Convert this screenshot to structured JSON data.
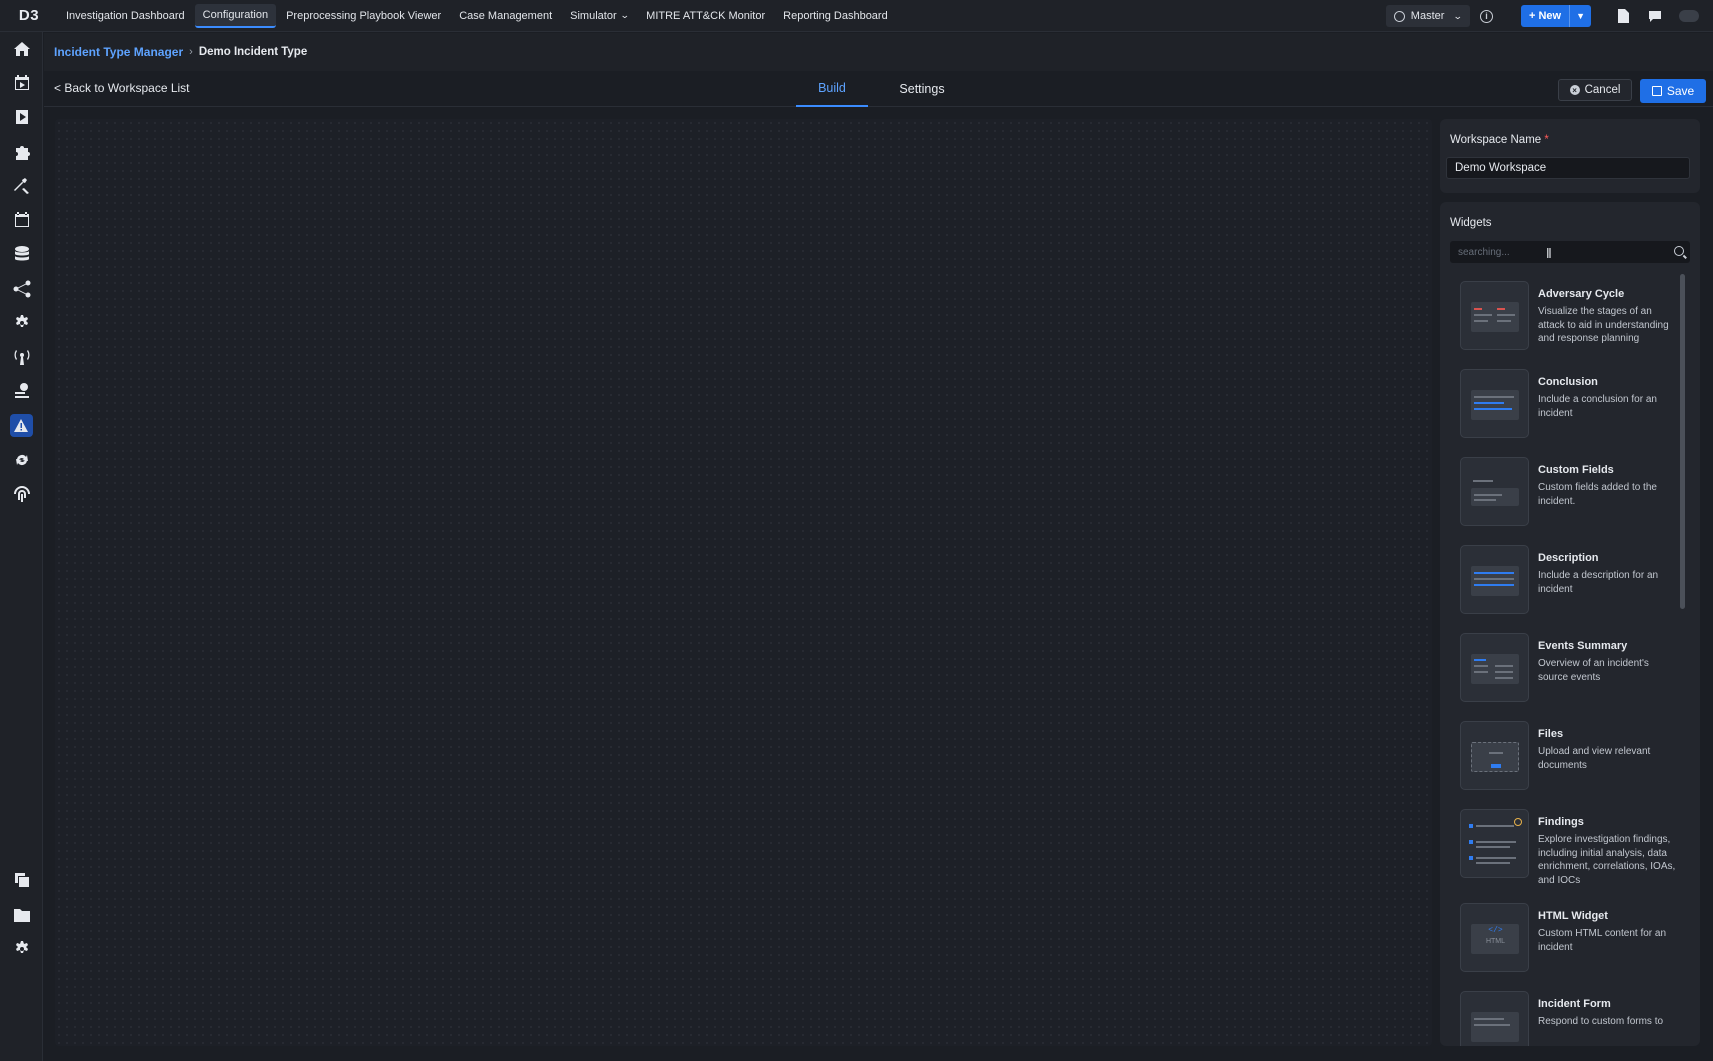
{
  "topnav": {
    "logo": "D3",
    "items": [
      {
        "label": "Investigation Dashboard",
        "active": false
      },
      {
        "label": "Configuration",
        "active": true
      },
      {
        "label": "Preprocessing Playbook Viewer",
        "active": false
      },
      {
        "label": "Case Management",
        "active": false
      },
      {
        "label": "Simulator",
        "active": false,
        "dropdown": true
      },
      {
        "label": "MITRE ATT&CK Monitor",
        "active": false
      },
      {
        "label": "Reporting Dashboard",
        "active": false
      }
    ],
    "master_label": "Master",
    "new_label": "+ New"
  },
  "breadcrumb": {
    "parent": "Incident Type Manager",
    "current": "Demo Incident Type"
  },
  "subheader": {
    "back_label": "< Back to Workspace List",
    "tabs": [
      {
        "label": "Build",
        "active": true
      },
      {
        "label": "Settings",
        "active": false
      }
    ],
    "cancel_label": "Cancel",
    "save_label": "Save"
  },
  "workspace": {
    "label": "Workspace Name",
    "required_mark": "*",
    "value": "Demo Workspace"
  },
  "widgets": {
    "title": "Widgets",
    "search_placeholder": "searching...",
    "items": [
      {
        "name": "Adversary Cycle",
        "desc": "Visualize the stages of an attack to aid in understanding and response planning"
      },
      {
        "name": "Conclusion",
        "desc": "Include a conclusion for an incident"
      },
      {
        "name": "Custom Fields",
        "desc": "Custom fields added to the incident."
      },
      {
        "name": "Description",
        "desc": "Include a description for an incident"
      },
      {
        "name": "Events Summary",
        "desc": "Overview of an incident's source events"
      },
      {
        "name": "Files",
        "desc": "Upload and view relevant documents"
      },
      {
        "name": "Findings",
        "desc": "Explore investigation findings, including initial analysis, data enrichment, correlations, IOAs, and IOCs"
      },
      {
        "name": "HTML Widget",
        "desc": "Custom HTML content for an incident"
      },
      {
        "name": "Incident Form",
        "desc": "Respond to custom forms to"
      }
    ]
  },
  "colors": {
    "accent": "#1f6fe6",
    "link": "#5ea3ff",
    "background": "#1b1e24"
  }
}
